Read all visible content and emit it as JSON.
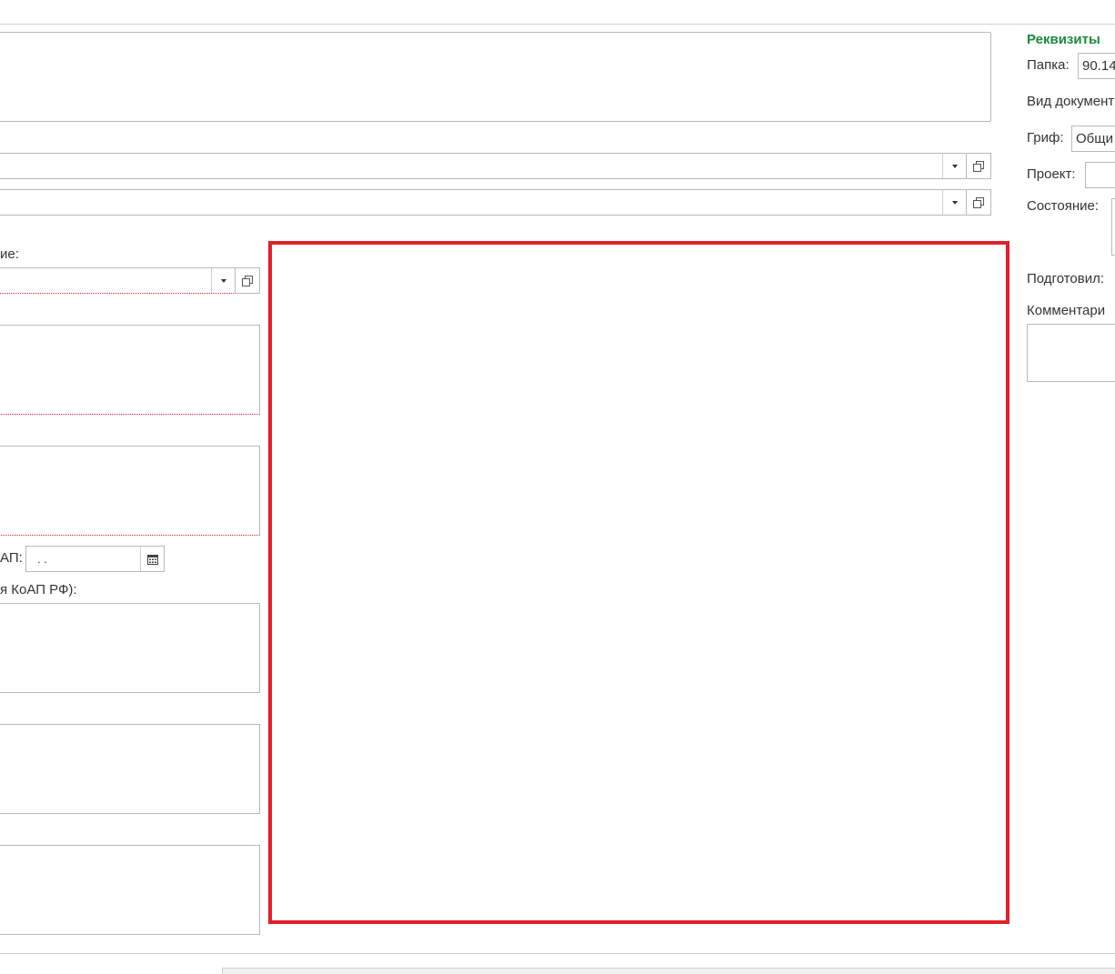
{
  "requisites": {
    "section_title": "Реквизиты",
    "folder_label": "Папка:",
    "folder_value": "90.14",
    "doc_type_label": "Вид документ",
    "grif_label": "Гриф:",
    "grif_value": "Общи",
    "project_label": "Проект:",
    "state_label": "Состояние:",
    "prepared_label": "Подготовил:",
    "comment_label": "Комментари"
  },
  "form": {
    "field_label_1": "ие:",
    "date_label": "АП:",
    "date_value": " .  .",
    "koap_label": "я КоАП РФ):"
  },
  "colors": {
    "accent_green": "#1a8a3e",
    "highlight_red": "#e0202a"
  }
}
